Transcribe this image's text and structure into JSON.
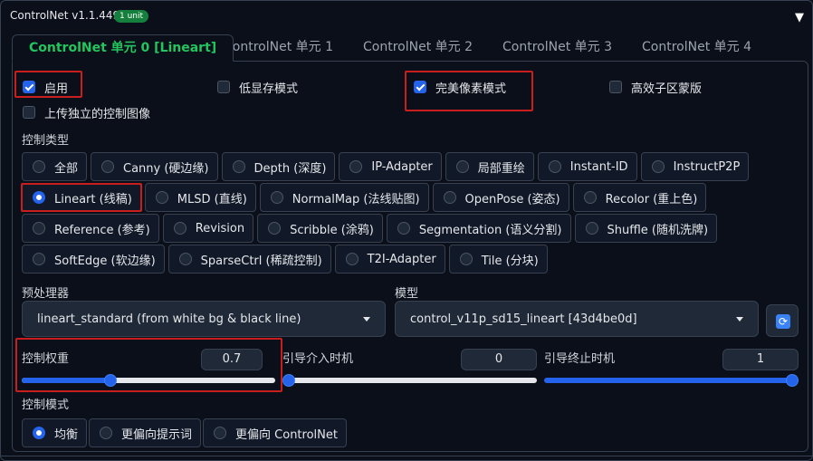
{
  "header": {
    "title": "ControlNet v1.1.449",
    "badge": "1 unit"
  },
  "tabs": [
    {
      "label": "ControlNet 单元 0 [Lineart]",
      "active": true
    },
    {
      "label": "ControlNet 单元 1",
      "active": false
    },
    {
      "label": "ControlNet 单元 2",
      "active": false
    },
    {
      "label": "ControlNet 单元 3",
      "active": false
    },
    {
      "label": "ControlNet 单元 4",
      "active": false
    }
  ],
  "checkboxes": {
    "enable": {
      "label": "启用",
      "checked": true
    },
    "low_vram": {
      "label": "低显存模式",
      "checked": false
    },
    "pixel_perfect": {
      "label": "完美像素模式",
      "checked": true
    },
    "efficient_mask": {
      "label": "高效子区蒙版",
      "checked": false
    },
    "upload_independent": {
      "label": "上传独立的控制图像",
      "checked": false
    }
  },
  "control_type": {
    "label": "控制类型",
    "selected": "Lineart (线稿)",
    "rows": [
      [
        "全部",
        "Canny (硬边缘)",
        "Depth (深度)",
        "IP-Adapter",
        "局部重绘",
        "Instant-ID",
        "InstructP2P"
      ],
      [
        "Lineart (线稿)",
        "MLSD (直线)",
        "NormalMap (法线贴图)",
        "OpenPose (姿态)",
        "Recolor (重上色)"
      ],
      [
        "Reference (参考)",
        "Revision",
        "Scribble (涂鸦)",
        "Segmentation (语义分割)",
        "Shuffle (随机洗牌)"
      ],
      [
        "SoftEdge (软边缘)",
        "SparseCtrl (稀疏控制)",
        "T2I-Adapter",
        "Tile (分块)"
      ]
    ]
  },
  "preprocessor": {
    "label": "预处理器",
    "value": "lineart_standard (from white bg & black line)"
  },
  "model": {
    "label": "模型",
    "value": "control_v11p_sd15_lineart [43d4be0d]"
  },
  "sliders": {
    "weight": {
      "label": "控制权重",
      "value": "0.7",
      "fraction": 0.35
    },
    "start": {
      "label": "引导介入时机",
      "value": "0",
      "fraction": 0
    },
    "end": {
      "label": "引导终止时机",
      "value": "1",
      "fraction": 1
    }
  },
  "control_mode": {
    "label": "控制模式",
    "selected": "均衡",
    "options": [
      "均衡",
      "更偏向提示词",
      "更偏向 ControlNet"
    ]
  },
  "colors": {
    "accent": "#2563eb",
    "active_tab": "#22c55e",
    "highlight": "#c81e1e",
    "background": "#0b0f19"
  }
}
